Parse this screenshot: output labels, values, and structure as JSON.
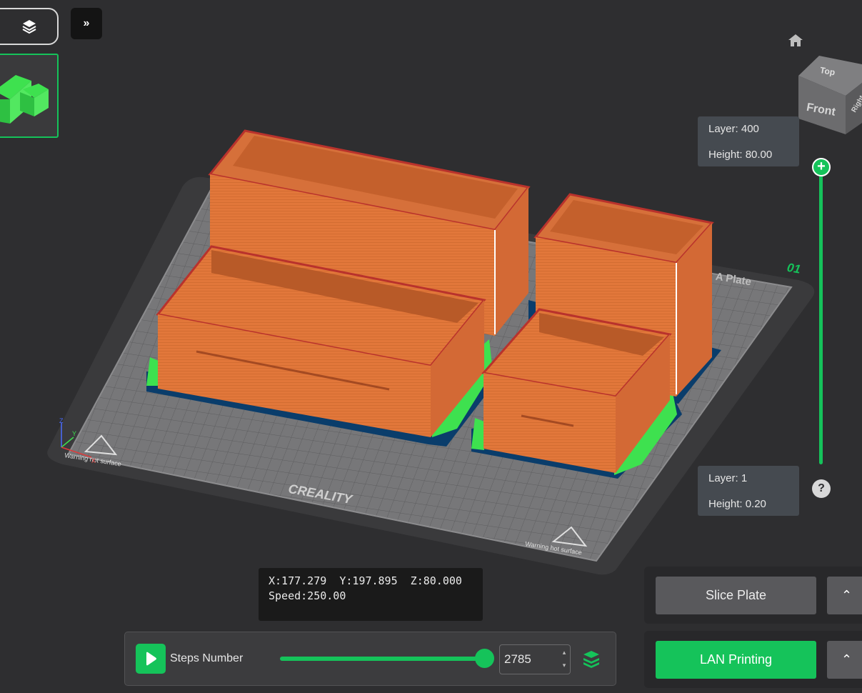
{
  "layer_top": {
    "layer": "Layer: 400",
    "height": "Height: 80.00"
  },
  "layer_bottom": {
    "layer": "Layer: 1",
    "height": "Height: 0.20"
  },
  "plate_number": "01",
  "plate_name": "A Plate",
  "bed_brand": "CREALITY",
  "bed_warning": "Warning hot surface",
  "view_cube": {
    "top": "Top",
    "front": "Front",
    "right": "Right"
  },
  "axes": {
    "x": "X",
    "y": "Y",
    "z": "Z"
  },
  "coords": {
    "line1": "X:177.279  Y:197.895  Z:80.000",
    "line2": "Speed:250.00"
  },
  "toolbar": {
    "steps_label": "Steps Number",
    "steps_value": "2785"
  },
  "actions": {
    "slice": "Slice Plate",
    "lan": "LAN Printing"
  },
  "icons": {
    "view_toggle": "layers-icon",
    "expand": "double-chevron-right-icon",
    "home": "home-icon",
    "help": "help-icon",
    "play": "play-icon",
    "layers_stack": "layers-stack-icon",
    "dropdown": "chevron-up-icon"
  },
  "colors": {
    "accent": "#15c35a",
    "model": "#e2773a",
    "support": "#3ee14f",
    "brim": "#0a3d6b",
    "background": "#2e2e30"
  }
}
